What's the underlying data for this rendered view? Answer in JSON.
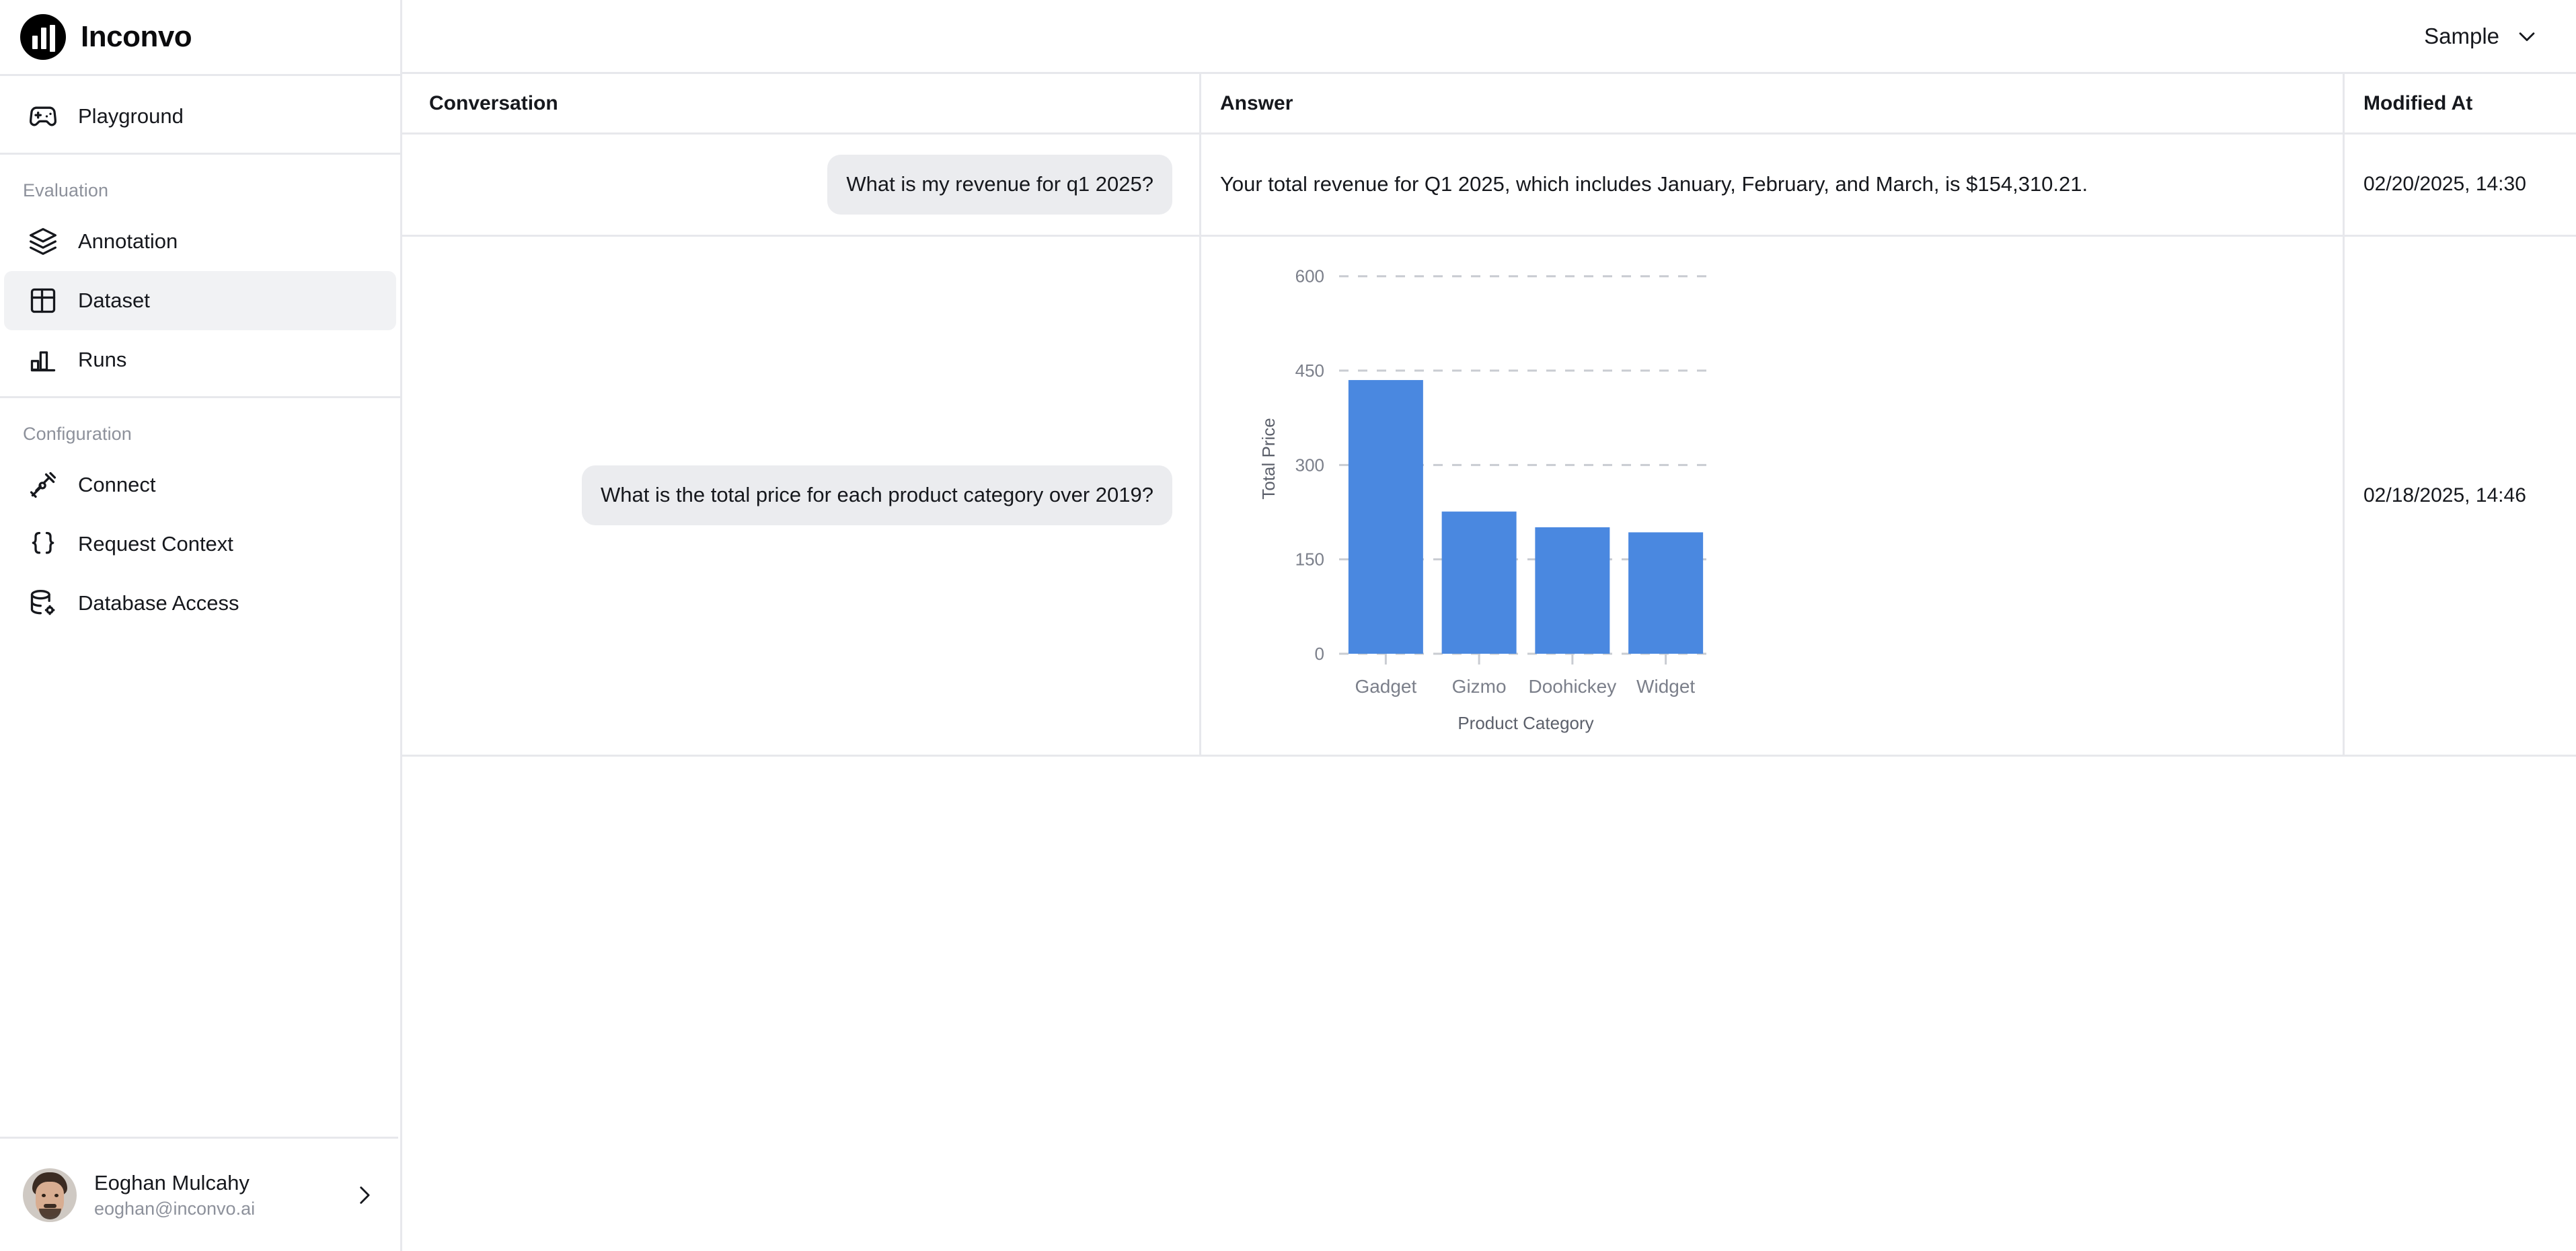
{
  "brand": {
    "name": "Inconvo",
    "logo_icon": "bar-chart-logo-icon"
  },
  "topbar": {
    "workspace": "Sample",
    "chevron_icon": "chevron-down-icon"
  },
  "sidebar": {
    "primary": [
      {
        "label": "Playground",
        "icon": "gamepad-icon",
        "active": false
      }
    ],
    "groups": [
      {
        "label": "Evaluation",
        "items": [
          {
            "label": "Annotation",
            "icon": "layers-icon",
            "active": false
          },
          {
            "label": "Dataset",
            "icon": "table-grid-icon",
            "active": true
          },
          {
            "label": "Runs",
            "icon": "bar-chart-icon",
            "active": false
          }
        ]
      },
      {
        "label": "Configuration",
        "items": [
          {
            "label": "Connect",
            "icon": "plug-connect-icon",
            "active": false
          },
          {
            "label": "Request Context",
            "icon": "curly-braces-icon",
            "active": false
          },
          {
            "label": "Database Access",
            "icon": "database-gear-icon",
            "active": false
          }
        ]
      }
    ],
    "user": {
      "name": "Eoghan Mulcahy",
      "email": "eoghan@inconvo.ai",
      "avatar_icon": "user-avatar",
      "chevron_icon": "chevron-right-icon"
    }
  },
  "table": {
    "columns": [
      "Conversation",
      "Answer",
      "Modified At"
    ],
    "rows": [
      {
        "conversation": "What is my revenue for q1 2025?",
        "answer": "Your total revenue for Q1 2025, which includes January, February, and March, is $154,310.21.",
        "modified_at": "02/20/2025, 14:30",
        "has_chart": false
      },
      {
        "conversation": "What is the total price for each product category over 2019?",
        "answer": "",
        "modified_at": "02/18/2025, 14:46",
        "has_chart": true
      }
    ]
  },
  "colors": {
    "bar": "#4a88e0",
    "grid": "#c9ccd2",
    "border": "#e7e8ec",
    "bubble": "#ebecef",
    "active_nav": "#f1f2f4",
    "muted_text": "#8d919b"
  },
  "chart_data": {
    "type": "bar",
    "title": "",
    "categories": [
      "Gadget",
      "Gizmo",
      "Doohickey",
      "Widget"
    ],
    "values": [
      435,
      226,
      201,
      193
    ],
    "xlabel": "Product Category",
    "ylabel": "Total Price",
    "yticks": [
      0,
      150,
      300,
      450,
      600
    ],
    "ylim": [
      0,
      620
    ],
    "grid": true,
    "grid_style": "dashed",
    "legend": false,
    "series": [
      {
        "name": "Total Price",
        "values": [
          435,
          226,
          201,
          193
        ]
      }
    ]
  }
}
